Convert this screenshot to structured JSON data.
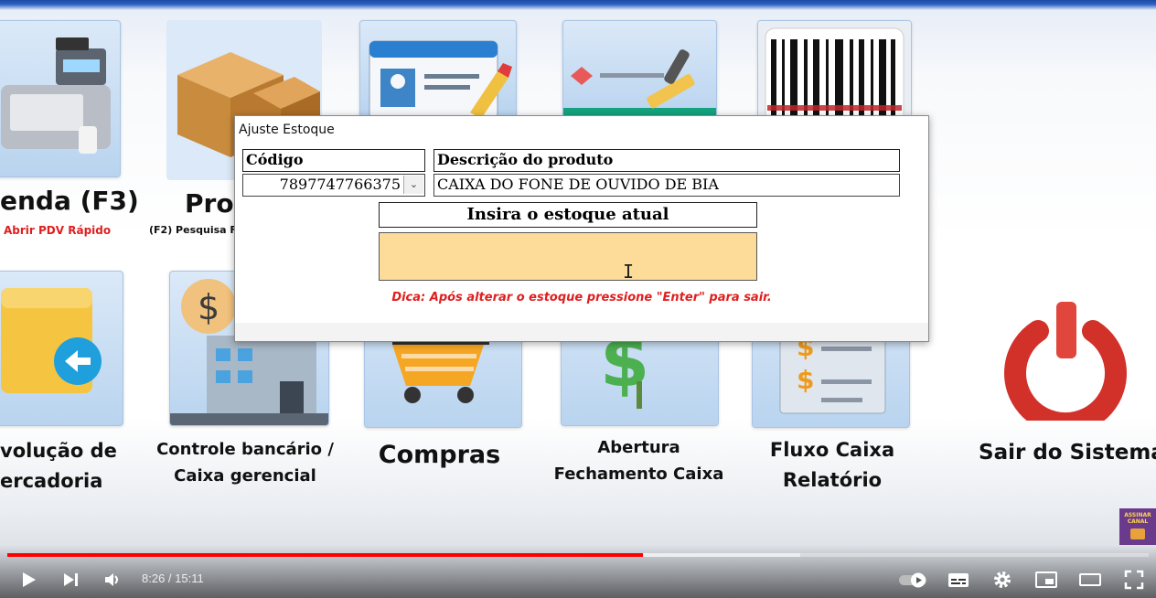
{
  "menu": {
    "venda": {
      "label": "enda (F3)",
      "sub": "Abrir PDV Rápido"
    },
    "produtos": {
      "label": "Prod",
      "sub": "(F2) Pesquisa F"
    },
    "devolucao": {
      "line1": "volução de",
      "line2": "ercadoria"
    },
    "controle": {
      "line1": "Controle bancário /",
      "line2": "Caixa gerencial"
    },
    "compras": {
      "label": "Compras"
    },
    "abertura": {
      "line1": "Abertura",
      "line2": "Fechamento Caixa"
    },
    "fluxo": {
      "line1": "Fluxo Caixa",
      "line2": "Relatório"
    },
    "sair": {
      "label": "Sair do Sistema"
    }
  },
  "dialog": {
    "title": "Ajuste Estoque",
    "codigo_label": "Código",
    "codigo_value": "7897747766375",
    "descricao_label": "Descrição do produto",
    "descricao_value": "CAIXA DO FONE DE OUVIDO DE BIA",
    "estoque_label": "Insira o estoque atual",
    "estoque_value": "",
    "hint": "Dica: Após alterar o estoque pressione \"Enter\" para sair."
  },
  "player": {
    "time": "8:26 / 15:11",
    "progress_played_fraction": 0.557,
    "progress_buffered_fraction": 0.695,
    "badge_text": "ASSINAR CANAL"
  },
  "colors": {
    "input_bg": "#fcdc98",
    "hint": "#e01e1e",
    "progress": "#ff0000",
    "venda_sub": "#e01e1e"
  }
}
